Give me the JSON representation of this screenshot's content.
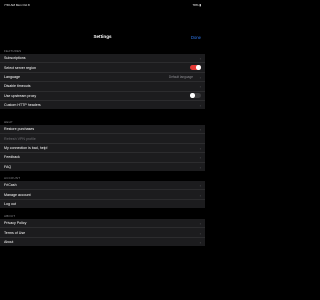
{
  "status_bar": {
    "time_date": "7:50 AM  Mon Oct 8",
    "battery": "78% ▮"
  },
  "nav": {
    "title": "Settings",
    "done_label": "Done"
  },
  "sections": [
    {
      "header": "FEATURES",
      "rows": [
        {
          "label": "Subscriptions",
          "type": "chevron"
        },
        {
          "label": "Select server region",
          "type": "toggle",
          "on": true
        },
        {
          "label": "Language",
          "type": "chevron",
          "value": "Default language"
        },
        {
          "label": "Disable timeouts",
          "type": "chevron"
        },
        {
          "label": "Use upstream proxy",
          "type": "toggle",
          "on": false
        },
        {
          "label": "Custom HTTP headers",
          "type": "chevron"
        }
      ]
    },
    {
      "header": "HELP",
      "rows": [
        {
          "label": "Restore purchases",
          "type": "chevron"
        },
        {
          "label": "Refresh VPN profile",
          "type": "dim"
        },
        {
          "label": "My connection is bad, help!",
          "type": "chevron"
        },
        {
          "label": "Feedback",
          "type": "chevron"
        },
        {
          "label": "FAQ",
          "type": "chevron"
        }
      ]
    },
    {
      "header": "ACCOUNT",
      "rows": [
        {
          "label": "FriCash",
          "type": "chevron"
        },
        {
          "label": "Manage account",
          "type": "chevron"
        },
        {
          "label": "Log out",
          "type": "plain"
        }
      ]
    },
    {
      "header": "ABOUT",
      "rows": [
        {
          "label": "Privacy Policy",
          "type": "chevron"
        },
        {
          "label": "Terms of Use",
          "type": "chevron"
        },
        {
          "label": "About",
          "type": "chevron"
        }
      ]
    }
  ],
  "colors": {
    "background": "#000000",
    "cell": "#1c1c1e",
    "accent_blue": "#2f7cf6",
    "toggle_on": "#e53935"
  },
  "icons": {
    "chevron": "chevron-right-icon"
  }
}
